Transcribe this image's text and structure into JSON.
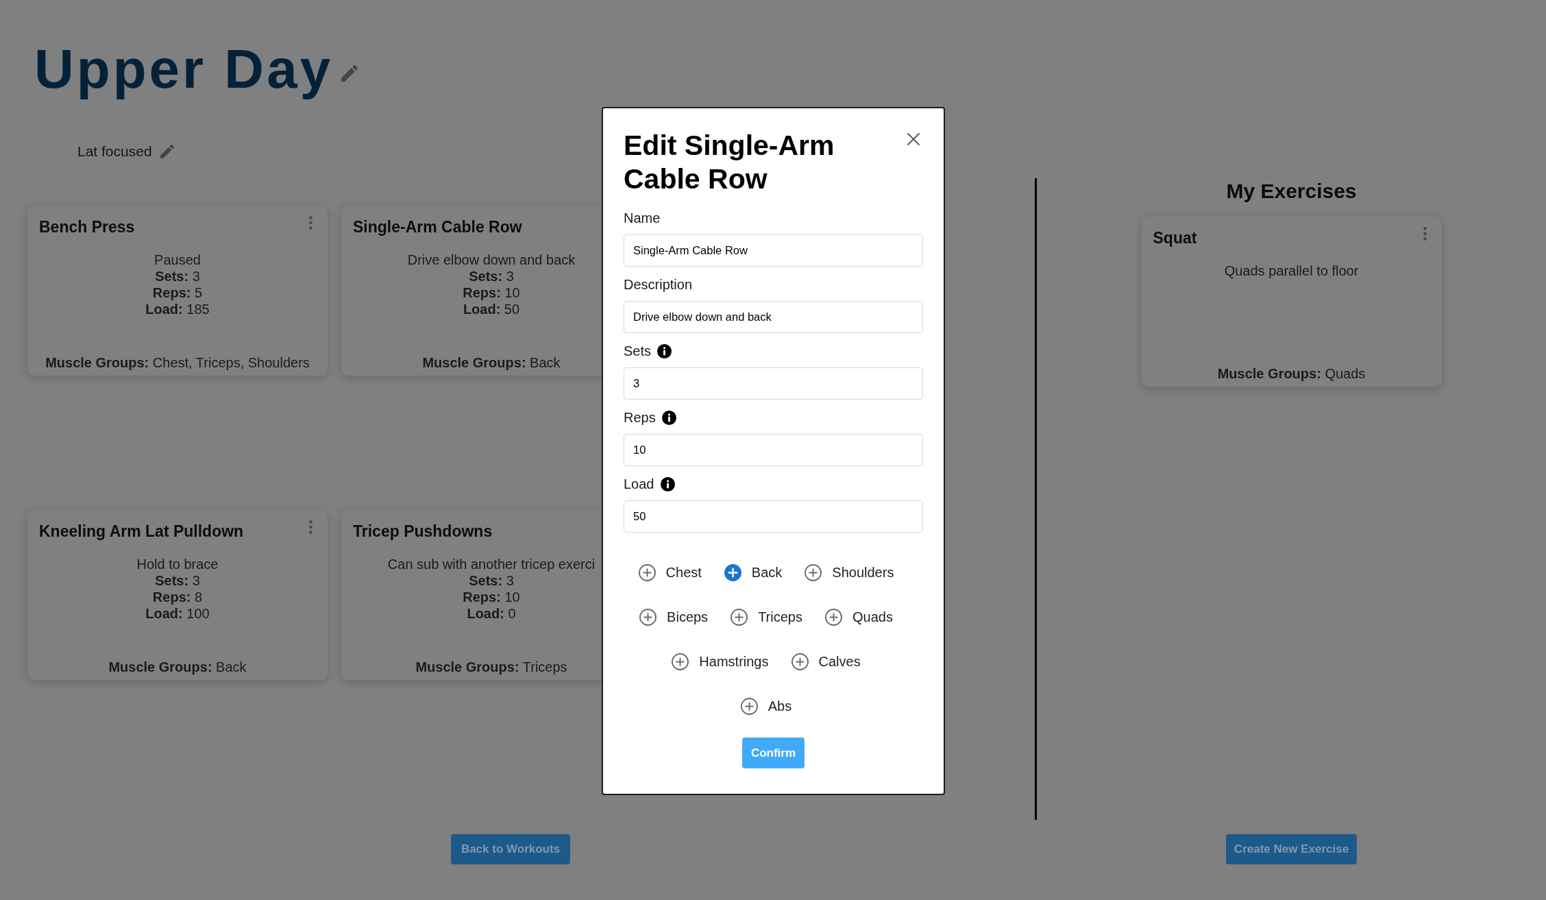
{
  "workout": {
    "title": "Upper Day",
    "description": "Lat focused"
  },
  "exercises": [
    {
      "title": "Bench Press",
      "menu_button": true,
      "description": "Paused",
      "stats": [
        "**Sets:** 3",
        "**Reps:** 5",
        "**Load:** 185"
      ],
      "muscle_groups": "**Muscle Groups:** Chest, Triceps, Shoulders"
    },
    {
      "title": "Single-Arm Cable Row",
      "menu_button": false,
      "description": "Drive elbow down and back",
      "stats": [
        "**Sets:** 3",
        "**Reps:** 10",
        "**Load:** 50"
      ],
      "muscle_groups": "**Muscle Groups:** Back"
    },
    {
      "title": "Kneeling Arm Lat Pulldown",
      "menu_button": true,
      "description": "Hold to brace",
      "stats": [
        "**Sets:** 3",
        "**Reps:** 8",
        "**Load:** 100"
      ],
      "muscle_groups": "**Muscle Groups:** Back"
    },
    {
      "title": "Tricep Pushdowns",
      "menu_button": false,
      "description": "Can sub with another tricep exerci",
      "stats": [
        "**Sets:** 3",
        "**Reps:** 10",
        "**Load:** 0"
      ],
      "muscle_groups": "**Muscle Groups:** Triceps"
    }
  ],
  "back_button": "Back to Workouts",
  "my_exercises": {
    "title": "My Exercises",
    "exercises": [
      {
        "title": "Squat",
        "menu_button": true,
        "description": "Quads parallel to floor",
        "muscle_groups": "**Muscle Groups:** Quads"
      }
    ],
    "create_button": "Create New Exercise"
  },
  "dialog": {
    "title": "Edit Single-Arm Cable Row",
    "fields": [
      {
        "label": "Name",
        "value": "Single-Arm Cable Row",
        "info": false
      },
      {
        "label": "Description",
        "value": "Drive elbow down and back",
        "info": false
      },
      {
        "label": "Sets",
        "value": "3",
        "info": true
      },
      {
        "label": "Reps",
        "value": "10",
        "info": true
      },
      {
        "label": "Load",
        "value": "50",
        "info": true
      }
    ],
    "muscle_groups": [
      {
        "label": "Chest",
        "selected": false
      },
      {
        "label": "Back",
        "selected": true
      },
      {
        "label": "Shoulders",
        "selected": false
      },
      {
        "label": "Biceps",
        "selected": false
      },
      {
        "label": "Triceps",
        "selected": false
      },
      {
        "label": "Quads",
        "selected": false
      },
      {
        "label": "Hamstrings",
        "selected": false
      },
      {
        "label": "Calves",
        "selected": false
      },
      {
        "label": "Abs",
        "selected": false
      }
    ],
    "confirm_button": "Confirm"
  }
}
